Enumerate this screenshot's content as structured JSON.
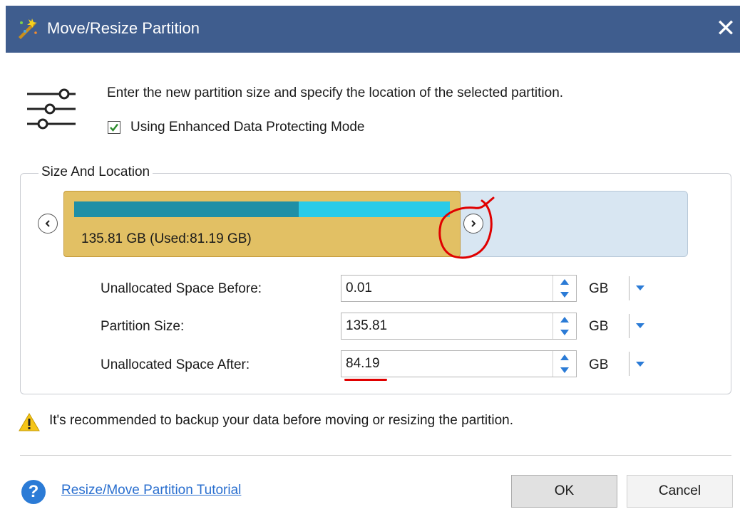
{
  "window": {
    "title": "Move/Resize Partition",
    "close_glyph": "✕"
  },
  "header": {
    "instruction": "Enter the new partition size and specify the location of the selected partition.",
    "enhanced_mode": {
      "label": "Using Enhanced Data Protecting Mode",
      "checked": true
    }
  },
  "size_location": {
    "title": "Size And Location",
    "partition": {
      "label": "135.81 GB (Used:81.19 GB)",
      "used_fraction": 0.598,
      "block_color": "#e2c064",
      "used_color": "#1f8fa6",
      "free_color": "#29cbe8"
    },
    "unallocated_color": "#d8e6f2",
    "fields": [
      {
        "label": "Unallocated Space Before:",
        "value": "0.01",
        "unit": "GB"
      },
      {
        "label": "Partition Size:",
        "value": "135.81",
        "unit": "GB"
      },
      {
        "label": "Unallocated Space After:",
        "value": "84.19",
        "unit": "GB"
      }
    ]
  },
  "warning": {
    "text": "It's recommended to backup your data before moving or resizing the partition."
  },
  "footer": {
    "help_glyph": "?",
    "tutorial_link": "Resize/Move Partition Tutorial",
    "ok_label": "OK",
    "cancel_label": "Cancel"
  },
  "colors": {
    "titlebar": "#3f5d8e",
    "annotation": "#e00000",
    "link": "#2a6fcf"
  }
}
